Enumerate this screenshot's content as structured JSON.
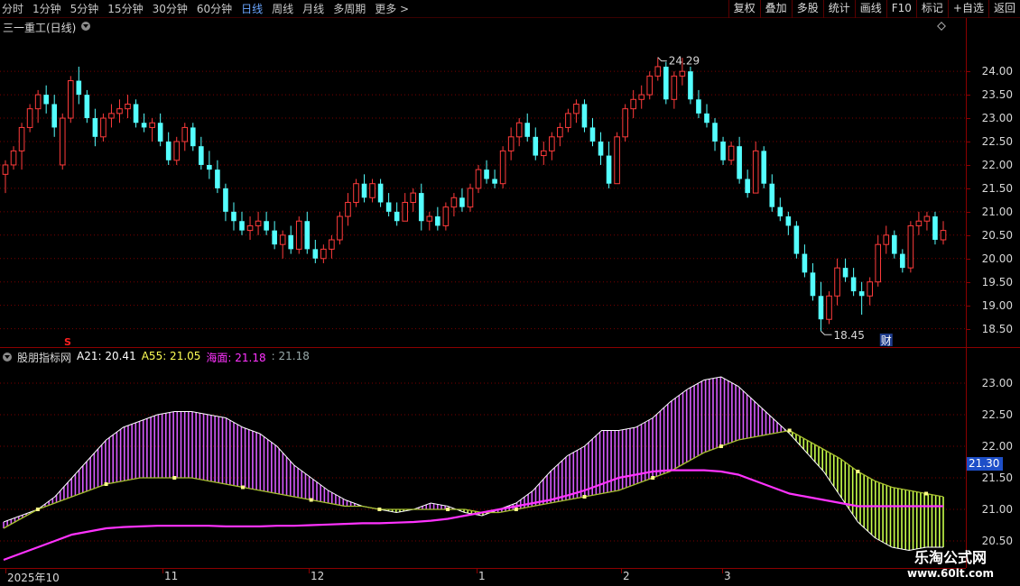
{
  "toolbar": {
    "left_items": [
      "分时",
      "1分钟",
      "5分钟",
      "15分钟",
      "30分钟",
      "60分钟",
      "日线",
      "周线",
      "月线",
      "多周期",
      "更多 >"
    ],
    "active_index": 6,
    "right_buttons": [
      "复权",
      "叠加",
      "多股",
      "统计",
      "画线",
      "F10",
      "标记",
      "+自选",
      "返回"
    ]
  },
  "main_header": {
    "title": "三一重工(日线)"
  },
  "price_axis": {
    "labels": [
      "24.00",
      "23.50",
      "23.00",
      "22.50",
      "22.00",
      "21.50",
      "21.00",
      "20.50",
      "20.00",
      "19.50",
      "19.00",
      "18.50"
    ]
  },
  "indicator_axis": {
    "labels": [
      "23.00",
      "22.50",
      "22.00",
      "21.50",
      "21.00",
      "20.50"
    ],
    "current_badge": "21.30"
  },
  "indicator_header": {
    "name": "股朋指标网",
    "a21_label": "A21: 20.41",
    "a55_label": "A55: 21.05",
    "haimian_label": "海面: 21.18",
    "extra_label": ": 21.18"
  },
  "annotations": {
    "high_label": "24.29",
    "low_label": "18.45",
    "finance_marker": "财",
    "signal_marker": "S"
  },
  "time_axis": {
    "labels": [
      "2025年10",
      "11",
      "12",
      "1",
      "2",
      "3"
    ]
  },
  "watermark": {
    "line1": "乐淘公式网",
    "line2": "www.60lt.com"
  },
  "colors": {
    "up": "#ff3b3b",
    "down": "#54ffff",
    "grid": "#7a0000",
    "a55": "#ff33ff",
    "haimian": "#ffffff",
    "sea_up": "#d85cff",
    "sea_down": "#c8ff4a"
  },
  "chart_data": {
    "type": "candlestick",
    "ylim": [
      18.3,
      24.6
    ],
    "candles": [
      [
        21.8,
        22.1,
        21.4,
        22.0
      ],
      [
        22.0,
        22.4,
        21.9,
        22.3
      ],
      [
        22.3,
        22.9,
        21.9,
        22.8
      ],
      [
        22.8,
        23.3,
        22.7,
        23.2
      ],
      [
        23.2,
        23.6,
        22.9,
        23.5
      ],
      [
        23.5,
        23.7,
        23.1,
        23.3
      ],
      [
        23.3,
        23.5,
        22.6,
        22.8
      ],
      [
        22.0,
        23.1,
        21.9,
        23.0
      ],
      [
        23.0,
        23.9,
        22.9,
        23.8
      ],
      [
        23.8,
        24.1,
        23.3,
        23.5
      ],
      [
        23.5,
        23.6,
        22.9,
        23.0
      ],
      [
        23.0,
        23.2,
        22.4,
        22.6
      ],
      [
        22.6,
        23.1,
        22.5,
        23.0
      ],
      [
        23.0,
        23.3,
        22.8,
        23.1
      ],
      [
        23.1,
        23.4,
        22.9,
        23.2
      ],
      [
        23.2,
        23.5,
        23.0,
        23.3
      ],
      [
        23.3,
        23.4,
        22.8,
        22.9
      ],
      [
        22.9,
        23.1,
        22.7,
        22.8
      ],
      [
        22.8,
        23.0,
        22.5,
        22.9
      ],
      [
        22.9,
        23.1,
        22.4,
        22.5
      ],
      [
        22.5,
        22.7,
        22.0,
        22.1
      ],
      [
        22.1,
        22.6,
        22.0,
        22.5
      ],
      [
        22.5,
        22.9,
        22.3,
        22.8
      ],
      [
        22.8,
        22.9,
        22.3,
        22.4
      ],
      [
        22.4,
        22.6,
        21.9,
        22.0
      ],
      [
        22.0,
        22.3,
        21.7,
        21.9
      ],
      [
        21.9,
        22.1,
        21.4,
        21.5
      ],
      [
        21.5,
        21.6,
        20.8,
        21.0
      ],
      [
        21.0,
        21.2,
        20.6,
        20.8
      ],
      [
        20.8,
        21.0,
        20.5,
        20.6
      ],
      [
        20.6,
        20.9,
        20.4,
        20.7
      ],
      [
        20.7,
        21.0,
        20.5,
        20.8
      ],
      [
        20.8,
        21.0,
        20.5,
        20.6
      ],
      [
        20.6,
        20.8,
        20.2,
        20.3
      ],
      [
        20.3,
        20.6,
        20.0,
        20.5
      ],
      [
        20.5,
        20.7,
        20.1,
        20.2
      ],
      [
        20.2,
        20.9,
        20.1,
        20.8
      ],
      [
        20.8,
        21.0,
        20.1,
        20.2
      ],
      [
        20.2,
        20.4,
        19.9,
        20.0
      ],
      [
        20.0,
        20.3,
        19.9,
        20.2
      ],
      [
        20.2,
        20.5,
        20.0,
        20.4
      ],
      [
        20.4,
        21.0,
        20.3,
        20.9
      ],
      [
        20.9,
        21.4,
        20.7,
        21.2
      ],
      [
        21.2,
        21.7,
        21.1,
        21.6
      ],
      [
        21.6,
        21.8,
        21.2,
        21.3
      ],
      [
        21.3,
        21.7,
        21.2,
        21.6
      ],
      [
        21.6,
        21.7,
        21.1,
        21.2
      ],
      [
        21.2,
        21.4,
        20.9,
        21.0
      ],
      [
        21.0,
        21.2,
        20.7,
        20.8
      ],
      [
        20.8,
        21.4,
        20.8,
        21.2
      ],
      [
        21.2,
        21.5,
        21.0,
        21.4
      ],
      [
        21.4,
        21.6,
        20.6,
        20.8
      ],
      [
        20.8,
        21.0,
        20.6,
        20.9
      ],
      [
        20.9,
        21.1,
        20.6,
        20.7
      ],
      [
        20.7,
        21.2,
        20.6,
        21.1
      ],
      [
        21.1,
        21.4,
        20.9,
        21.3
      ],
      [
        21.3,
        21.5,
        21.0,
        21.1
      ],
      [
        21.1,
        21.6,
        21.0,
        21.5
      ],
      [
        21.5,
        22.0,
        21.4,
        21.9
      ],
      [
        21.9,
        22.1,
        21.6,
        21.7
      ],
      [
        21.7,
        21.9,
        21.5,
        21.6
      ],
      [
        21.6,
        22.4,
        21.5,
        22.3
      ],
      [
        22.3,
        22.8,
        22.1,
        22.6
      ],
      [
        22.6,
        23.0,
        22.4,
        22.9
      ],
      [
        22.9,
        23.1,
        22.5,
        22.6
      ],
      [
        22.6,
        22.8,
        22.1,
        22.2
      ],
      [
        22.2,
        22.5,
        22.0,
        22.3
      ],
      [
        22.3,
        22.7,
        22.1,
        22.6
      ],
      [
        22.6,
        22.9,
        22.4,
        22.8
      ],
      [
        22.8,
        23.2,
        22.7,
        23.1
      ],
      [
        23.1,
        23.4,
        22.9,
        23.3
      ],
      [
        23.3,
        23.4,
        22.7,
        22.8
      ],
      [
        22.8,
        23.0,
        22.4,
        22.5
      ],
      [
        22.5,
        22.7,
        22.0,
        22.2
      ],
      [
        22.2,
        22.5,
        21.5,
        21.6
      ],
      [
        21.6,
        22.7,
        21.6,
        22.6
      ],
      [
        22.6,
        23.3,
        22.5,
        23.2
      ],
      [
        23.2,
        23.6,
        23.0,
        23.4
      ],
      [
        23.4,
        23.7,
        23.2,
        23.5
      ],
      [
        23.5,
        24.0,
        23.4,
        23.9
      ],
      [
        23.9,
        24.3,
        23.8,
        24.1
      ],
      [
        24.1,
        24.2,
        23.3,
        23.4
      ],
      [
        23.4,
        24.0,
        23.2,
        23.9
      ],
      [
        23.9,
        24.29,
        23.7,
        24.0
      ],
      [
        24.0,
        24.1,
        23.3,
        23.4
      ],
      [
        23.4,
        23.6,
        23.0,
        23.1
      ],
      [
        23.1,
        23.3,
        22.8,
        22.9
      ],
      [
        22.9,
        23.0,
        22.3,
        22.5
      ],
      [
        22.5,
        22.6,
        22.0,
        22.1
      ],
      [
        22.1,
        22.5,
        22.0,
        22.4
      ],
      [
        22.4,
        22.6,
        21.6,
        21.7
      ],
      [
        21.7,
        21.9,
        21.3,
        21.4
      ],
      [
        21.4,
        22.5,
        21.4,
        22.3
      ],
      [
        22.3,
        22.4,
        21.5,
        21.6
      ],
      [
        21.6,
        21.8,
        21.0,
        21.1
      ],
      [
        21.1,
        21.3,
        20.8,
        20.9
      ],
      [
        20.9,
        21.0,
        20.5,
        20.7
      ],
      [
        20.7,
        20.8,
        20.0,
        20.1
      ],
      [
        20.1,
        20.3,
        19.6,
        19.7
      ],
      [
        19.7,
        19.9,
        19.1,
        19.2
      ],
      [
        19.2,
        19.5,
        18.45,
        18.7
      ],
      [
        18.7,
        19.3,
        18.6,
        19.2
      ],
      [
        19.2,
        20.0,
        19.0,
        19.8
      ],
      [
        19.8,
        20.0,
        19.5,
        19.6
      ],
      [
        19.6,
        19.8,
        19.2,
        19.3
      ],
      [
        19.3,
        19.5,
        18.8,
        19.2
      ],
      [
        19.2,
        19.6,
        19.0,
        19.5
      ],
      [
        19.5,
        20.5,
        19.4,
        20.3
      ],
      [
        20.3,
        20.7,
        20.1,
        20.5
      ],
      [
        20.5,
        20.6,
        20.0,
        20.1
      ],
      [
        20.1,
        20.2,
        19.7,
        19.8
      ],
      [
        19.8,
        20.8,
        19.7,
        20.7
      ],
      [
        20.7,
        21.0,
        20.5,
        20.8
      ],
      [
        20.8,
        21.0,
        20.6,
        20.9
      ],
      [
        20.9,
        21.0,
        20.3,
        20.4
      ],
      [
        20.4,
        20.8,
        20.3,
        20.6
      ]
    ],
    "indicator": {
      "ylim": [
        20.2,
        23.3
      ],
      "haimian": [
        20.8,
        20.9,
        21.0,
        21.2,
        21.5,
        21.8,
        22.1,
        22.3,
        22.4,
        22.5,
        22.55,
        22.55,
        22.5,
        22.45,
        22.3,
        22.2,
        22.0,
        21.7,
        21.5,
        21.3,
        21.15,
        21.05,
        21.0,
        20.95,
        21.0,
        21.1,
        21.05,
        20.95,
        20.9,
        21.0,
        21.1,
        21.3,
        21.6,
        21.85,
        22.0,
        22.25,
        22.25,
        22.3,
        22.45,
        22.7,
        22.9,
        23.05,
        23.1,
        22.95,
        22.7,
        22.45,
        22.2,
        21.9,
        21.6,
        21.2,
        20.8,
        20.55,
        20.4,
        20.35,
        20.4,
        20.4
      ],
      "midline": [
        20.7,
        20.85,
        21.0,
        21.1,
        21.2,
        21.3,
        21.4,
        21.45,
        21.5,
        21.5,
        21.5,
        21.5,
        21.45,
        21.4,
        21.35,
        21.3,
        21.25,
        21.2,
        21.15,
        21.1,
        21.05,
        21.05,
        21.0,
        21.0,
        21.0,
        21.0,
        21.0,
        21.0,
        20.95,
        20.95,
        21.0,
        21.05,
        21.1,
        21.15,
        21.2,
        21.25,
        21.3,
        21.4,
        21.5,
        21.6,
        21.75,
        21.9,
        22.0,
        22.1,
        22.15,
        22.2,
        22.25,
        22.1,
        21.95,
        21.8,
        21.6,
        21.45,
        21.35,
        21.3,
        21.25,
        21.2
      ],
      "a55": [
        20.2,
        20.3,
        20.4,
        20.5,
        20.6,
        20.65,
        20.7,
        20.72,
        20.73,
        20.74,
        20.74,
        20.74,
        20.74,
        20.73,
        20.73,
        20.73,
        20.74,
        20.74,
        20.75,
        20.76,
        20.77,
        20.78,
        20.78,
        20.79,
        20.8,
        20.82,
        20.85,
        20.9,
        20.95,
        21.0,
        21.05,
        21.1,
        21.15,
        21.22,
        21.3,
        21.4,
        21.5,
        21.55,
        21.6,
        21.62,
        21.62,
        21.62,
        21.6,
        21.55,
        21.45,
        21.35,
        21.25,
        21.2,
        21.15,
        21.1,
        21.05,
        21.05,
        21.05,
        21.05,
        21.05,
        21.05
      ]
    }
  }
}
